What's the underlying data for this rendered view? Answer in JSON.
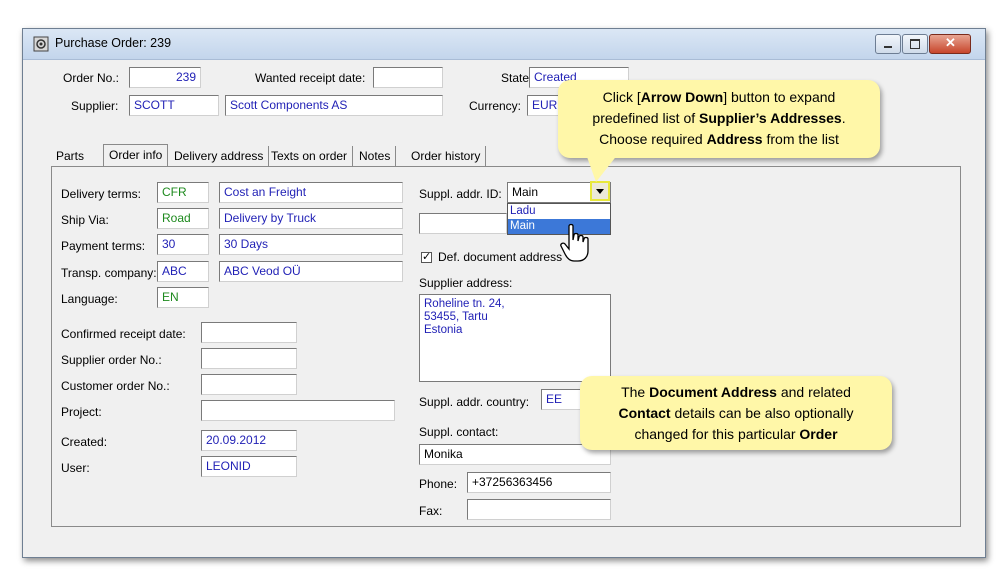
{
  "window": {
    "title": "Purchase Order: 239"
  },
  "header": {
    "order_no_label": "Order No.:",
    "order_no": "239",
    "wanted_date_label": "Wanted receipt date:",
    "wanted_date": "",
    "state_label": "State:",
    "state": "Created",
    "supplier_label": "Supplier:",
    "supplier_code": "SCOTT",
    "supplier_name": "Scott Components AS",
    "currency_label": "Currency:",
    "currency": "EUR"
  },
  "tabs": [
    {
      "label": "Parts"
    },
    {
      "label": "Order info"
    },
    {
      "label": "Delivery address"
    },
    {
      "label": "Texts on order"
    },
    {
      "label": "Notes"
    },
    {
      "label": "Order history"
    }
  ],
  "order_info": {
    "delivery_terms_label": "Delivery terms:",
    "delivery_terms_code": "CFR",
    "delivery_terms_desc": "Cost an Freight",
    "ship_via_label": "Ship Via:",
    "ship_via_code": "Road",
    "ship_via_desc": "Delivery by Truck",
    "payment_terms_label": "Payment terms:",
    "payment_terms_code": "30",
    "payment_terms_desc": "30 Days",
    "transp_label": "Transp. company:",
    "transp_code": "ABC",
    "transp_desc": "ABC Veod OÜ",
    "language_label": "Language:",
    "language": "EN",
    "confirmed_label": "Confirmed receipt date:",
    "confirmed": "",
    "supplier_order_label": "Supplier order No.:",
    "supplier_order": "",
    "customer_order_label": "Customer order No.:",
    "customer_order": "",
    "project_label": "Project:",
    "project": "",
    "created_label": "Created:",
    "created": "20.09.2012",
    "user_label": "User:",
    "user": "LEONID"
  },
  "address": {
    "addr_id_label": "Suppl. addr. ID:",
    "addr_id": "Main",
    "options": [
      "Ladu",
      "Main"
    ],
    "def_doc_label": "Def. document address",
    "supplier_address_label": "Supplier address:",
    "supplier_address": "Roheline tn. 24,\n53455, Tartu\nEstonia",
    "country_label": "Suppl. addr. country:",
    "country": "EE",
    "contact_label": "Suppl. contact:",
    "contact": "Monika",
    "phone_label": "Phone:",
    "phone": "+37256363456",
    "fax_label": "Fax:",
    "fax": ""
  },
  "callouts": {
    "top": {
      "t1": "Click [",
      "b1": "Arrow Down",
      "t2": "] button to expand",
      "t3": "predefined list of ",
      "b2": "Supplier’s Addresses",
      "t4": ".",
      "t5": "Choose required ",
      "b3": "Address",
      "t6": " from the list"
    },
    "bottom": {
      "t1": "The ",
      "b1": "Document Address",
      "t2": " and related",
      "b2": "Contact",
      "t3": " details can be also optionally",
      "t4": "changed for this particular ",
      "b3": "Order"
    }
  },
  "colors": {
    "field_text": "#1f1fb5",
    "callout_bg": "#fff7a8",
    "selected": "#3c78d8"
  }
}
